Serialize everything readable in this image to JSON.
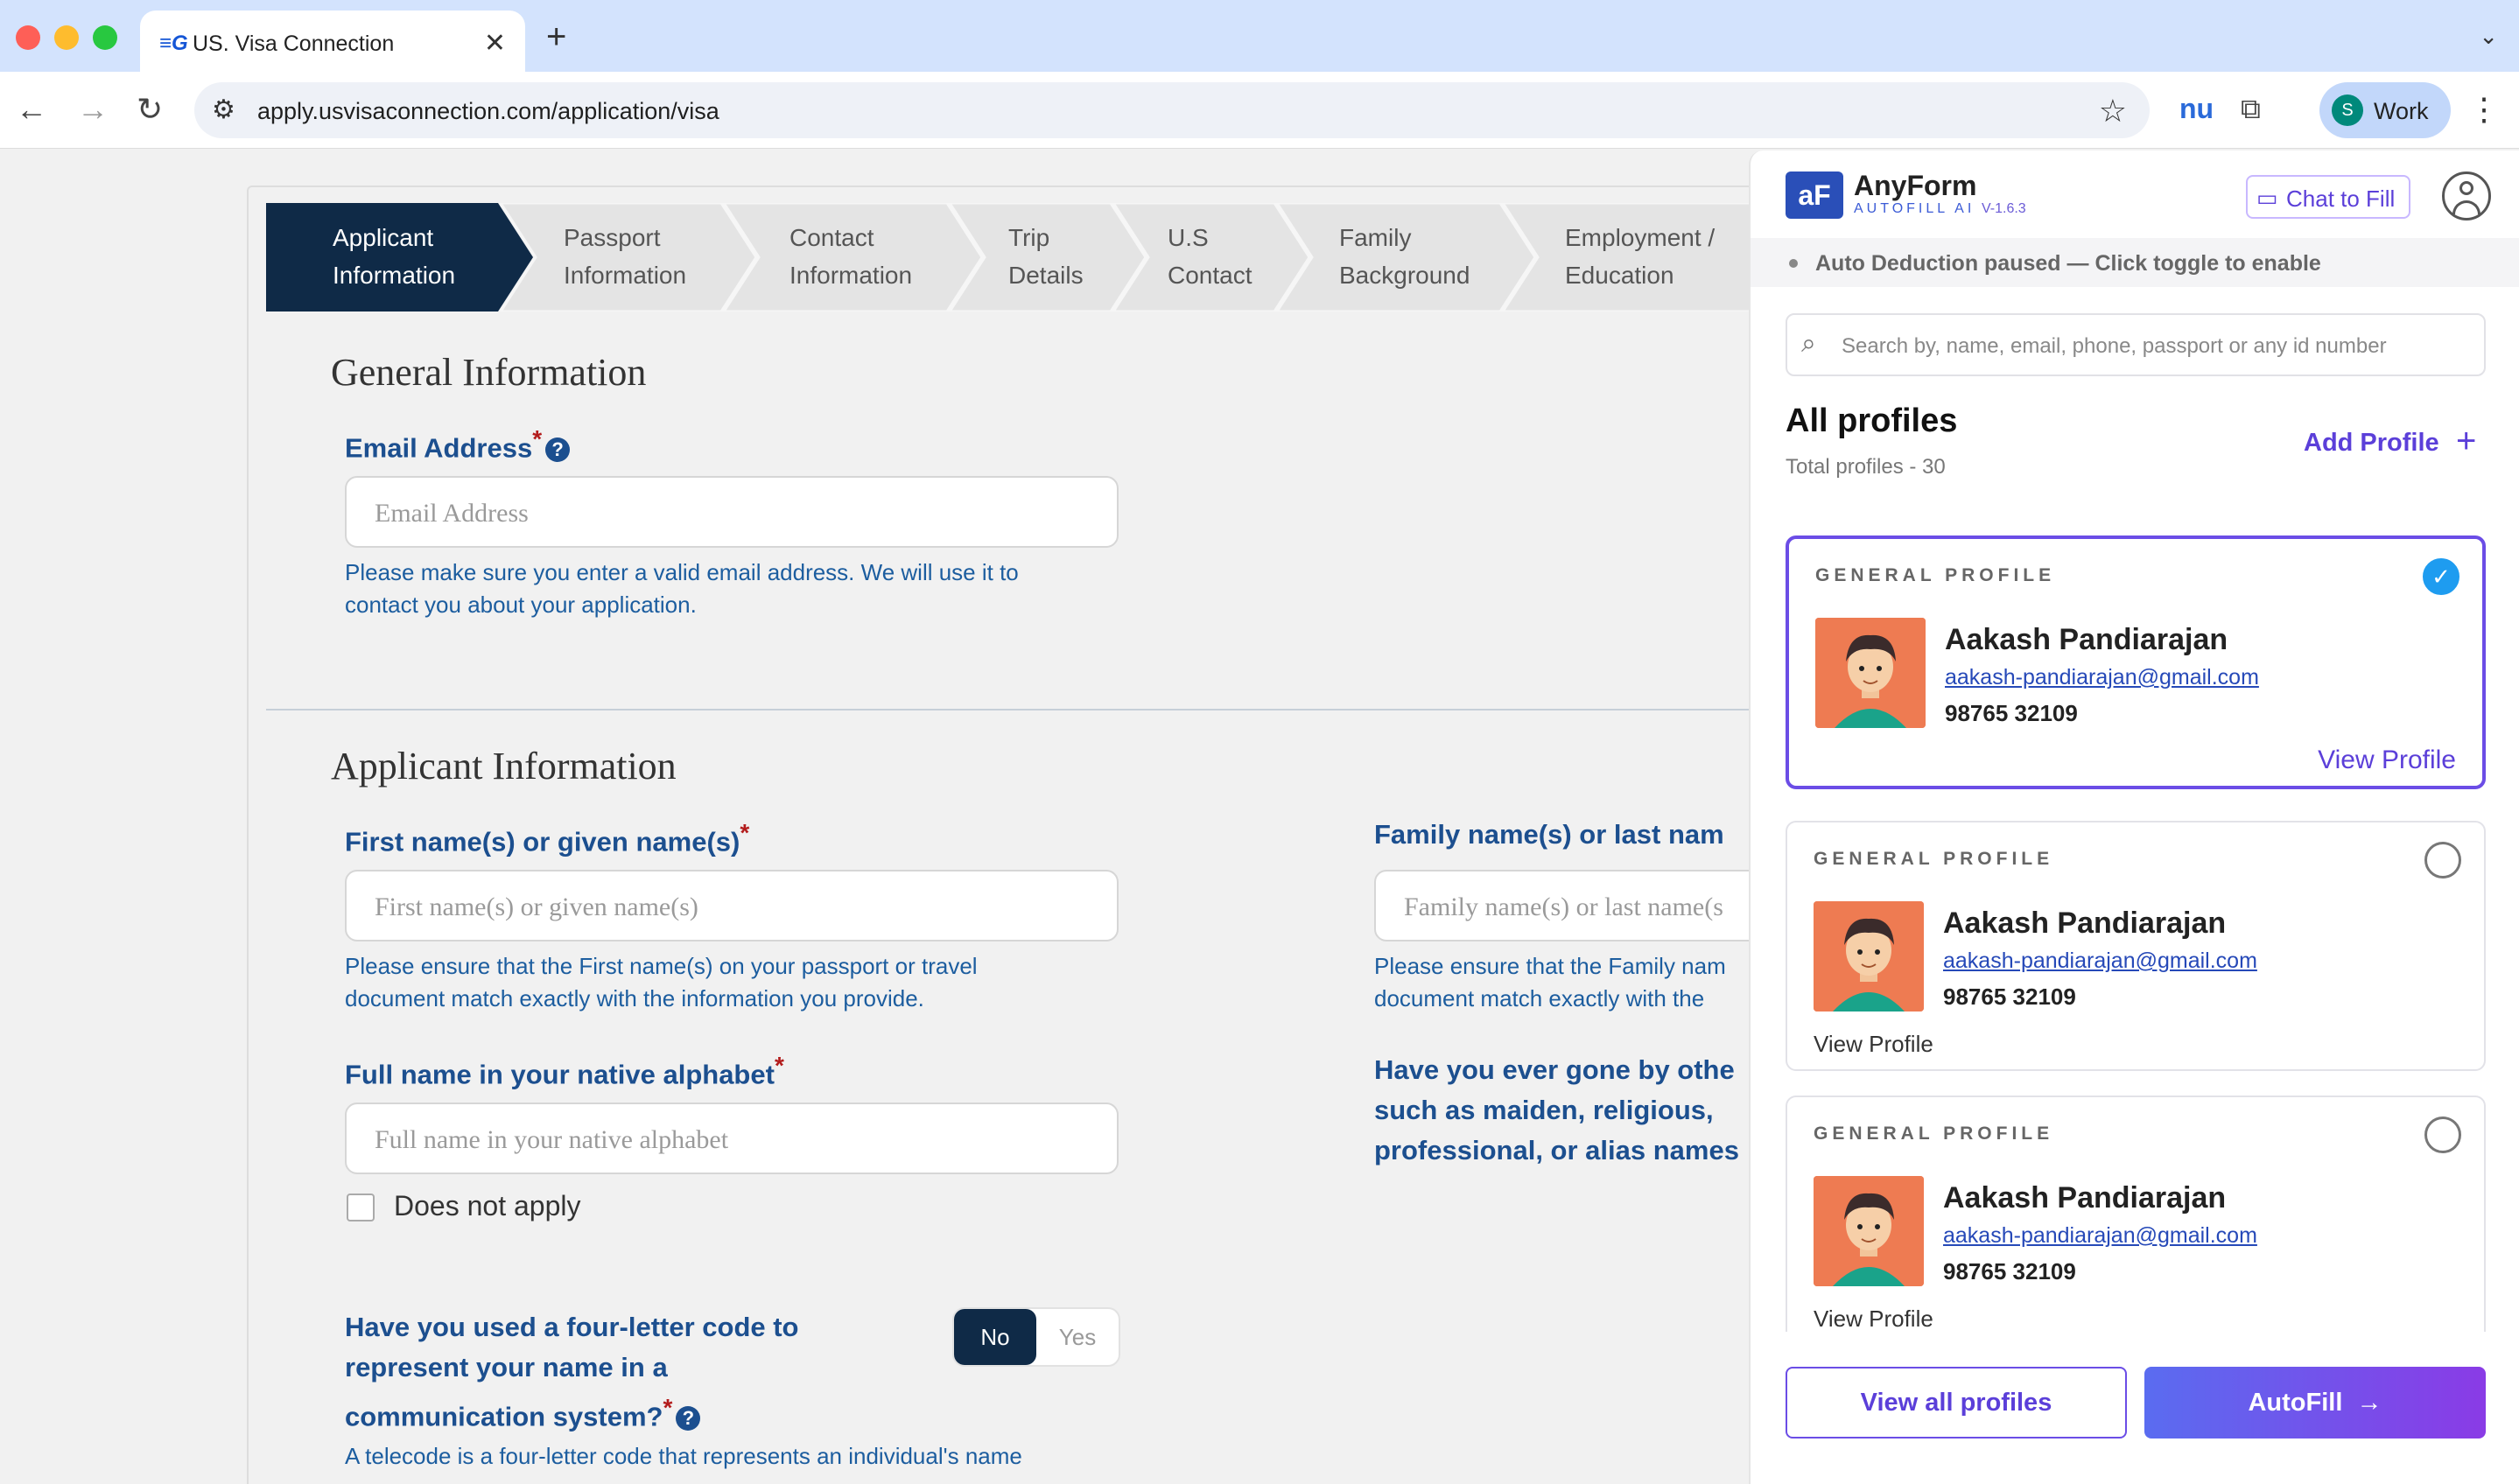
{
  "browser": {
    "tab_title": "US. Visa Connection",
    "url": "apply.usvisaconnection.com/application/visa",
    "profile_initial": "S",
    "profile_name": "Work",
    "extension_label": "nu"
  },
  "steps": [
    {
      "line1": "Applicant",
      "line2": "Information",
      "active": true
    },
    {
      "line1": "Passport",
      "line2": "Information"
    },
    {
      "line1": "Contact",
      "line2": "Information"
    },
    {
      "line1": "Trip",
      "line2": "Details"
    },
    {
      "line1": "U.S",
      "line2": "Contact"
    },
    {
      "line1": "Family",
      "line2": "Background"
    },
    {
      "line1": "Employment /",
      "line2": "Education"
    }
  ],
  "general": {
    "title": "General Information",
    "email_label": "Email Address",
    "email_placeholder": "Email Address",
    "email_hint_1": "Please make sure you enter a valid email address. We will use it to",
    "email_hint_2": "contact you about your application."
  },
  "applicant": {
    "title": "Applicant Information",
    "first_label": "First name(s) or given name(s)",
    "first_placeholder": "First name(s) or given name(s)",
    "first_hint_1": "Please ensure that the First name(s) on your passport or travel",
    "first_hint_2": "document match exactly with the information you provide.",
    "family_label": "Family name(s) or last nam",
    "family_placeholder": "Family name(s) or last name(s",
    "family_hint_1": "Please ensure that the Family nam",
    "family_hint_2": "document match exactly with the",
    "native_label": "Full name in your native alphabet",
    "native_placeholder": "Full name in your native alphabet",
    "does_not_apply": "Does not apply",
    "other_q_1": "Have you ever gone by othe",
    "other_q_2": "such as maiden, religious,",
    "other_q_3": "professional, or alias names",
    "telecode_q_1": "Have you used a four-letter code to",
    "telecode_q_2": "represent your name in a",
    "telecode_q_3": "communication system?",
    "toggle_no": "No",
    "toggle_yes": "Yes",
    "telecode_hint": "A telecode is a four-letter code that represents an individual's name"
  },
  "panel": {
    "logo": "aF",
    "brand": "AnyForm",
    "brand_sub": "AUTOFILL AI",
    "version": "V-1.6.3",
    "chat_label": "Chat to Fill",
    "status": "Auto Deduction paused — Click toggle to enable",
    "search_placeholder": "Search by, name, email, phone, passport or any id number",
    "all_profiles": "All profiles",
    "total_profiles": "Total profiles - 30",
    "add_profile": "Add Profile",
    "profiles": [
      {
        "kind": "GENERAL PROFILE",
        "name": "Aakash Pandiarajan",
        "email": "aakash-pandiarajan@gmail.com",
        "phone": "98765 32109",
        "view": "View Profile",
        "selected": true
      },
      {
        "kind": "GENERAL PROFILE",
        "name": "Aakash Pandiarajan",
        "email": "aakash-pandiarajan@gmail.com",
        "phone": "98765 32109",
        "view": "View Profile",
        "selected": false
      },
      {
        "kind": "GENERAL PROFILE",
        "name": "Aakash Pandiarajan",
        "email": "aakash-pandiarajan@gmail.com",
        "phone": "98765 32109",
        "view": "View Profile",
        "selected": false
      }
    ],
    "view_all": "View all profiles",
    "autofill": "AutoFill"
  }
}
